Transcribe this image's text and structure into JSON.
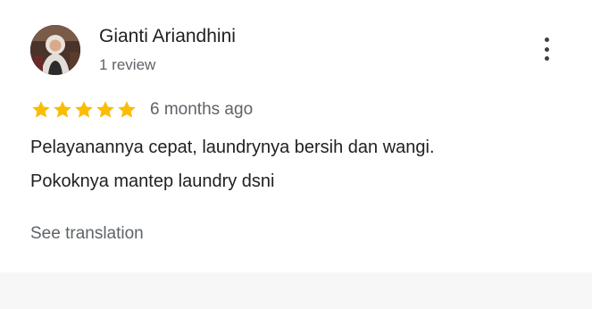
{
  "review": {
    "reviewer_name": "Gianti Ariandhini",
    "review_count": "1 review",
    "rating": 5,
    "rating_max": 5,
    "date": "6 months ago",
    "text_lines": [
      "Pelayanannya cepat, laundrynya bersih dan wangi.",
      "Pokoknya mantep laundry dsni"
    ],
    "see_translation_label": "See translation"
  },
  "icons": {
    "more": "more-vert-icon",
    "star": "star-icon"
  },
  "colors": {
    "star": "#fbbc04",
    "name": "#202124",
    "secondary_text": "#5f6368"
  }
}
